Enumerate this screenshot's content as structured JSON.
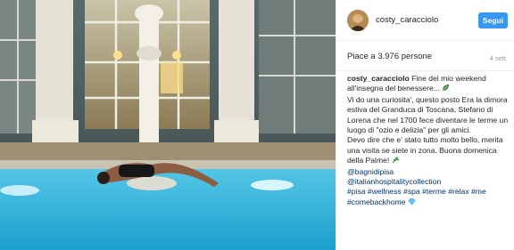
{
  "header": {
    "username": "costy_caracciolo",
    "follow_label": "Segui"
  },
  "likes": {
    "text": "Piace a 3.976 persone",
    "date": "4 sett."
  },
  "caption": {
    "username": "costy_caracciolo",
    "line1": "Fine del mio weekend all'insegna del benessere...",
    "line2": "Vi do una curiosita', questo posto Era la dimora estiva del Granduca di Toscana, Stefano di Lorena che nel 1700 fece diventare le terme un luogo di \"ozio e delizia\" per gli amici.",
    "line3": "Devo dire che e' stato tutto molto bello, merita una visita se siete in zona. Buona domenica della Palme!",
    "mention1": "@bagnidipisa",
    "mention2": "@italianhospitalitycollection",
    "hashtags": "#pisa #wellness #spa #terme #relax #me #comebackhome"
  },
  "icons": {
    "leaf_emoji": "leaf-emoji-icon",
    "branch_emoji": "branch-emoji-icon",
    "diamond_emoji": "diamond-emoji-icon"
  },
  "colors": {
    "follow_button": "#3897f0",
    "link": "#003569",
    "pool": "#2fb7e0"
  }
}
